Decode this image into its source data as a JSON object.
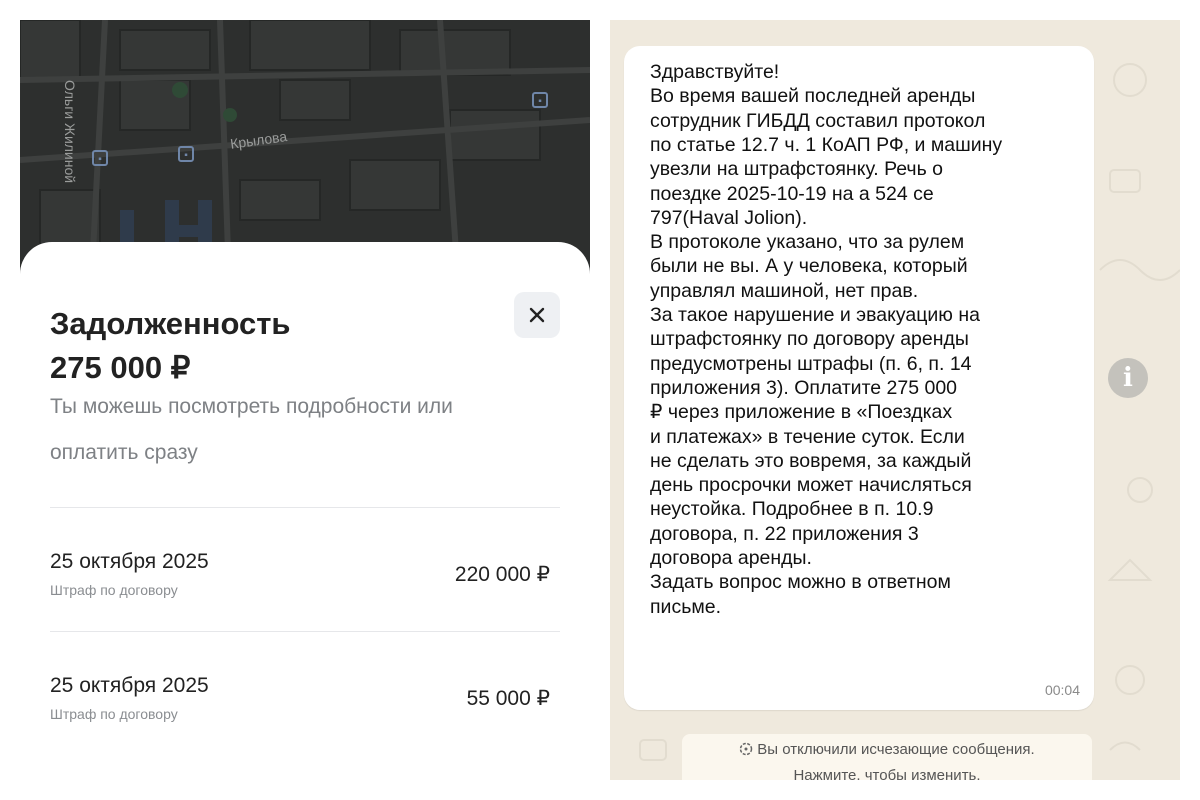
{
  "left": {
    "map": {
      "street_vertical": "Ольги Жилиной",
      "street_horizontal": "Крылова"
    },
    "sheet": {
      "title_line1": "Задолженность",
      "title_line2": "275 000 ₽",
      "close_icon": "close-icon",
      "description_line1": "Ты можешь посмотреть подробности или",
      "description_line2": "оплатить сразу",
      "fines": [
        {
          "date": "25 октября 2025",
          "note": "Штраф по договору",
          "amount": "220 000 ₽"
        },
        {
          "date": "25 октября 2025",
          "note": "Штраф по договору",
          "amount": "55 000 ₽"
        }
      ]
    }
  },
  "right": {
    "message": {
      "lines": [
        "Здравствуйте!",
        "Во время вашей последней аренды",
        "сотрудник ГИБДД составил протокол",
        "по статье 12.7 ч. 1 КоАП РФ, и машину",
        "увезли на штрафстоянку. Речь о",
        "поездке 2025-10-19 на а 524 се",
        "797(Haval Jolion).",
        "В протоколе указано, что за рулем",
        "были не вы. А у человека, который",
        "управлял машиной, нет прав.",
        "За такое нарушение и эвакуацию на",
        "штрафстоянку по договору аренды",
        "предусмотрены штрафы (п. 6, п. 14",
        "приложения 3). Оплатите 275 000",
        "₽ через приложение в «Поездках",
        "и платежах» в течение суток. Если",
        "не сделать это вовремя, за каждый",
        "день просрочки может начисляться",
        "неустойка. Подробнее в п. 10.9",
        "договора, п. 22 приложения 3",
        "договора аренды.",
        "Задать вопрос можно в ответном",
        "письме."
      ],
      "time": "00:04"
    },
    "info_icon": "info-icon",
    "system_message": {
      "line1": "Вы отключили исчезающие сообщения.",
      "line2": "Нажмите, чтобы изменить."
    }
  },
  "colors": {
    "map_background": "#2d2f2e",
    "chat_background": "#efe9dd",
    "bubble": "#ffffff",
    "muted_text": "#7e8185"
  }
}
